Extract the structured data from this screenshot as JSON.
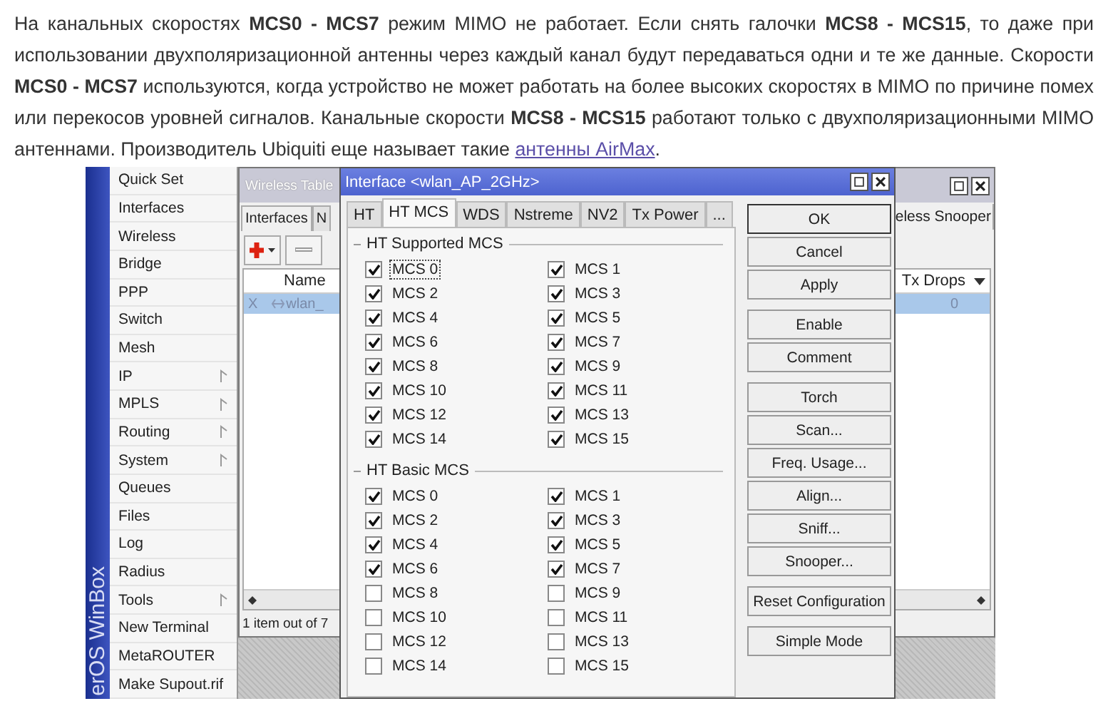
{
  "article": {
    "text": "На канальных скоростях **MCS0 - MCS7** режим MIMO не работает. Если снять галочки **MCS8 - MCS15**, то даже при использовании двухполяризационной антенны через каждый канал будут передаваться одни и те же данные. Скорости **MCS0 - MCS7** используются, когда устройство не может работать на более высоких скоростях в MIMO по причине помех или перекосов уровней сигналов. Канальные скорости **MCS8 - MCS15** работают только с двухполяризационными MIMO антеннами. Производитель Ubiquiti еще называет такие ",
    "link": "антенны AirMax",
    "text_after": "."
  },
  "winbox": {
    "brand": "erOS WinBox",
    "menu": [
      {
        "label": "Quick Set",
        "submenu": false
      },
      {
        "label": "Interfaces",
        "submenu": false
      },
      {
        "label": "Wireless",
        "submenu": false
      },
      {
        "label": "Bridge",
        "submenu": false
      },
      {
        "label": "PPP",
        "submenu": false
      },
      {
        "label": "Switch",
        "submenu": false
      },
      {
        "label": "Mesh",
        "submenu": false
      },
      {
        "label": "IP",
        "submenu": true
      },
      {
        "label": "MPLS",
        "submenu": true
      },
      {
        "label": "Routing",
        "submenu": true
      },
      {
        "label": "System",
        "submenu": true
      },
      {
        "label": "Queues",
        "submenu": false
      },
      {
        "label": "Files",
        "submenu": false
      },
      {
        "label": "Log",
        "submenu": false
      },
      {
        "label": "Radius",
        "submenu": false
      },
      {
        "label": "Tools",
        "submenu": true
      },
      {
        "label": "New Terminal",
        "submenu": false
      },
      {
        "label": "MetaROUTER",
        "submenu": false
      },
      {
        "label": "Make Supout.rif",
        "submenu": false
      }
    ]
  },
  "wireless_tables": {
    "title": "Wireless Table",
    "tabs": [
      {
        "label": "Interfaces",
        "selected": true
      },
      {
        "label": "N",
        "selected": false
      }
    ],
    "right_tab": "eless Snooper",
    "columns": [
      "Name",
      "Tx Drops"
    ],
    "rows": [
      {
        "flag": "X",
        "name": "wlan_",
        "tx_drops": "0",
        "selected": true
      }
    ],
    "status": "1 item out of 7"
  },
  "dialog": {
    "title": "Interface <wlan_AP_2GHz>",
    "tabs": [
      {
        "label": "HT",
        "selected": false
      },
      {
        "label": "HT MCS",
        "selected": true
      },
      {
        "label": "WDS",
        "selected": false
      },
      {
        "label": "Nstreme",
        "selected": false
      },
      {
        "label": "NV2",
        "selected": false
      },
      {
        "label": "Tx Power",
        "selected": false
      },
      {
        "label": "...",
        "selected": false
      }
    ],
    "groups": [
      {
        "title": "HT Supported MCS",
        "items": [
          {
            "label": "MCS 0",
            "checked": true,
            "focused": true
          },
          {
            "label": "MCS 1",
            "checked": true,
            "focused": false
          },
          {
            "label": "MCS 2",
            "checked": true,
            "focused": false
          },
          {
            "label": "MCS 3",
            "checked": true,
            "focused": false
          },
          {
            "label": "MCS 4",
            "checked": true,
            "focused": false
          },
          {
            "label": "MCS 5",
            "checked": true,
            "focused": false
          },
          {
            "label": "MCS 6",
            "checked": true,
            "focused": false
          },
          {
            "label": "MCS 7",
            "checked": true,
            "focused": false
          },
          {
            "label": "MCS 8",
            "checked": true,
            "focused": false
          },
          {
            "label": "MCS 9",
            "checked": true,
            "focused": false
          },
          {
            "label": "MCS 10",
            "checked": true,
            "focused": false
          },
          {
            "label": "MCS 11",
            "checked": true,
            "focused": false
          },
          {
            "label": "MCS 12",
            "checked": true,
            "focused": false
          },
          {
            "label": "MCS 13",
            "checked": true,
            "focused": false
          },
          {
            "label": "MCS 14",
            "checked": true,
            "focused": false
          },
          {
            "label": "MCS 15",
            "checked": true,
            "focused": false
          }
        ]
      },
      {
        "title": "HT Basic MCS",
        "items": [
          {
            "label": "MCS 0",
            "checked": true,
            "focused": false
          },
          {
            "label": "MCS 1",
            "checked": true,
            "focused": false
          },
          {
            "label": "MCS 2",
            "checked": true,
            "focused": false
          },
          {
            "label": "MCS 3",
            "checked": true,
            "focused": false
          },
          {
            "label": "MCS 4",
            "checked": true,
            "focused": false
          },
          {
            "label": "MCS 5",
            "checked": true,
            "focused": false
          },
          {
            "label": "MCS 6",
            "checked": true,
            "focused": false
          },
          {
            "label": "MCS 7",
            "checked": true,
            "focused": false
          },
          {
            "label": "MCS 8",
            "checked": false,
            "focused": false
          },
          {
            "label": "MCS 9",
            "checked": false,
            "focused": false
          },
          {
            "label": "MCS 10",
            "checked": false,
            "focused": false
          },
          {
            "label": "MCS 11",
            "checked": false,
            "focused": false
          },
          {
            "label": "MCS 12",
            "checked": false,
            "focused": false
          },
          {
            "label": "MCS 13",
            "checked": false,
            "focused": false
          },
          {
            "label": "MCS 14",
            "checked": false,
            "focused": false
          },
          {
            "label": "MCS 15",
            "checked": false,
            "focused": false
          }
        ]
      }
    ],
    "button_groups": [
      [
        {
          "label": "OK",
          "default": true
        },
        {
          "label": "Cancel",
          "default": false
        },
        {
          "label": "Apply",
          "default": false
        }
      ],
      [
        {
          "label": "Enable",
          "default": false
        },
        {
          "label": "Comment",
          "default": false
        }
      ],
      [
        {
          "label": "Torch",
          "default": false
        },
        {
          "label": "Scan...",
          "default": false
        },
        {
          "label": "Freq. Usage...",
          "default": false
        },
        {
          "label": "Align...",
          "default": false
        },
        {
          "label": "Sniff...",
          "default": false
        },
        {
          "label": "Snooper...",
          "default": false
        }
      ],
      [
        {
          "label": "Reset Configuration",
          "default": false
        }
      ],
      [
        {
          "label": "Simple Mode",
          "default": false
        }
      ]
    ]
  }
}
